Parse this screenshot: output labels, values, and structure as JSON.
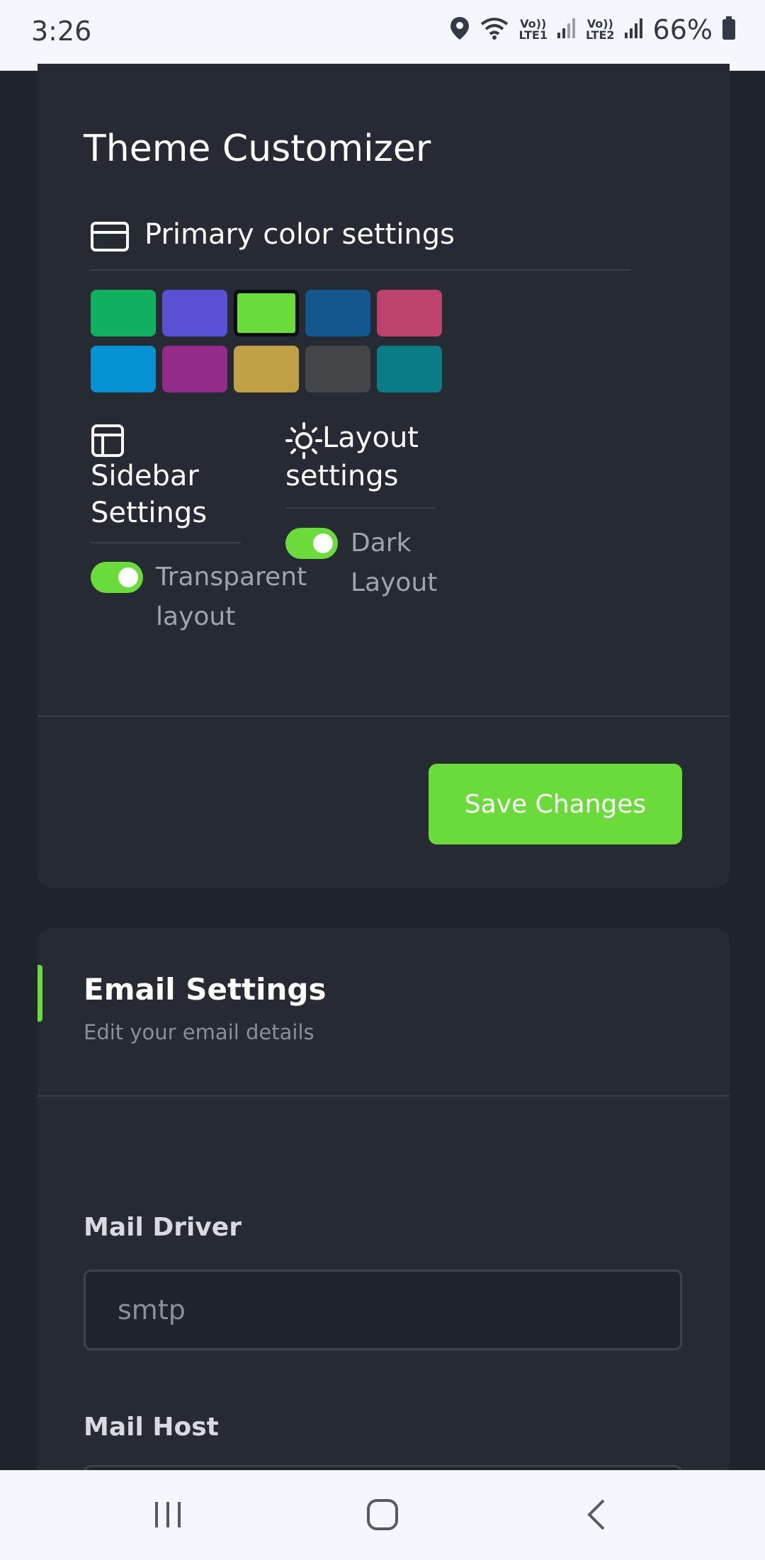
{
  "status_bar": {
    "time": "3:26",
    "sim1": {
      "volte": "Vo))",
      "lte": "LTE1"
    },
    "sim2": {
      "volte": "Vo))",
      "lte": "LTE2"
    },
    "battery": "66%"
  },
  "theme": {
    "title": "Theme Customizer",
    "primary_color_label": "Primary color settings",
    "colors": [
      {
        "hex": "#0fb05f",
        "selected": false
      },
      {
        "hex": "#5a50d6",
        "selected": false
      },
      {
        "hex": "#6bdb3c",
        "selected": true
      },
      {
        "hex": "#13578f",
        "selected": false
      },
      {
        "hex": "#bd426c",
        "selected": false
      },
      {
        "hex": "#0691d2",
        "selected": false
      },
      {
        "hex": "#922c88",
        "selected": false
      },
      {
        "hex": "#c0a044",
        "selected": false
      },
      {
        "hex": "#434546",
        "selected": false
      },
      {
        "hex": "#0b7b86",
        "selected": false
      }
    ],
    "sidebar_settings": {
      "label_line1": "Sidebar",
      "label_line2": "Settings",
      "toggle_line1": "Transparent",
      "toggle_line2": "layout",
      "toggle_on": true
    },
    "layout_settings": {
      "label_line1": "Layout",
      "label_line2": "settings",
      "toggle_line1": "Dark",
      "toggle_line2": "Layout",
      "toggle_on": true
    },
    "save_button": "Save Changes"
  },
  "email": {
    "title": "Email Settings",
    "subtitle": "Edit your email details",
    "mail_driver_label": "Mail Driver",
    "mail_driver_value": "smtp",
    "mail_host_label": "Mail Host"
  },
  "accent_color": "#6bdb3c"
}
